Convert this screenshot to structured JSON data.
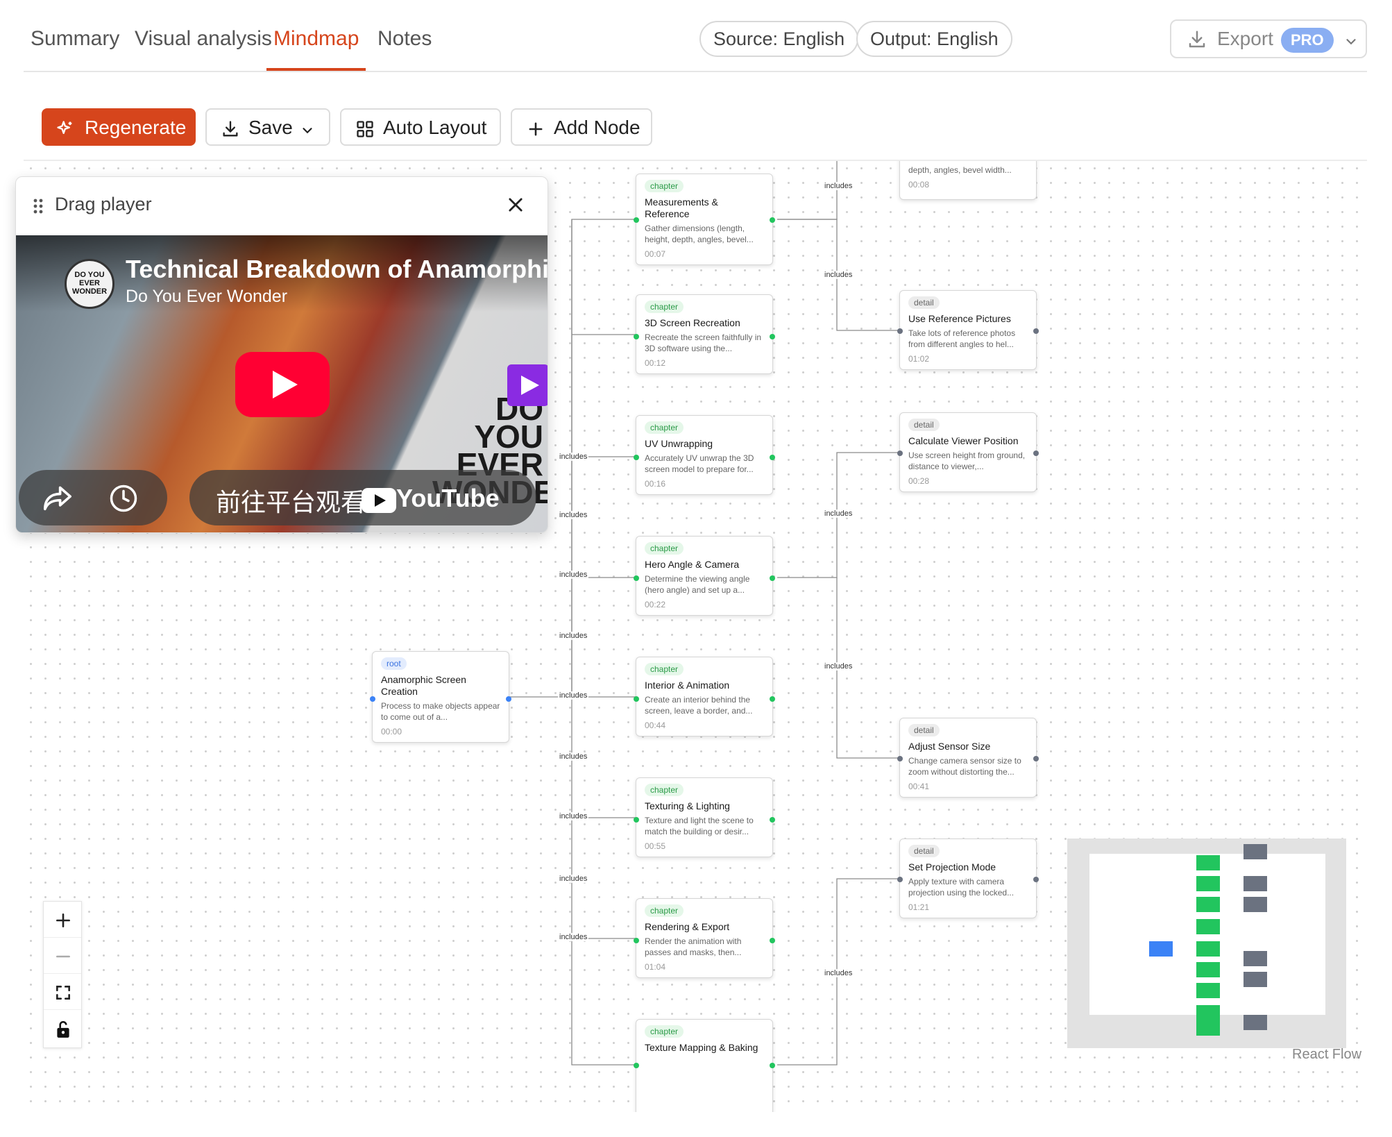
{
  "tabs": [
    "Summary",
    "Visual analysis",
    "Mindmap",
    "Notes"
  ],
  "active_tab": "Mindmap",
  "source_label": "Source: English",
  "output_label": "Output: English",
  "export": {
    "label": "Export",
    "badge": "PRO"
  },
  "toolbar": {
    "regenerate": "Regenerate",
    "save": "Save",
    "auto_layout": "Auto Layout",
    "add_node": "Add Node"
  },
  "player": {
    "header": "Drag player",
    "video_title": "Technical Breakdown of Anamorphic",
    "channel": "Do You Ever Wonder",
    "logo_text": "DO YOU EVER WONDER",
    "overlay_text": "DO YOU EVER WONDER",
    "watch_text": "前往平台观看：",
    "platform": "YouTube"
  },
  "edge_label": "includes",
  "root": {
    "type": "root",
    "title": "Anamorphic Screen Creation",
    "desc": "Process to make objects appear to come out of a...",
    "time": "00:00"
  },
  "chapters": [
    {
      "type": "chapter",
      "title": "Measurements & Reference",
      "desc": "Gather dimensions (length, height, depth, angles, bevel...",
      "time": "00:07"
    },
    {
      "type": "chapter",
      "title": "3D Screen Recreation",
      "desc": "Recreate the screen faithfully in 3D software using the...",
      "time": "00:12"
    },
    {
      "type": "chapter",
      "title": "UV Unwrapping",
      "desc": "Accurately UV unwrap the 3D screen model to prepare for...",
      "time": "00:16"
    },
    {
      "type": "chapter",
      "title": "Hero Angle & Camera",
      "desc": "Determine the viewing angle (hero angle) and set up a...",
      "time": "00:22"
    },
    {
      "type": "chapter",
      "title": "Interior & Animation",
      "desc": "Create an interior behind the screen, leave a border, and...",
      "time": "00:44"
    },
    {
      "type": "chapter",
      "title": "Texturing & Lighting",
      "desc": "Texture and light the scene to match the building or desir...",
      "time": "00:55"
    },
    {
      "type": "chapter",
      "title": "Rendering & Export",
      "desc": "Render the animation with passes and masks, then...",
      "time": "01:04"
    },
    {
      "type": "chapter",
      "title": "Texture Mapping & Baking",
      "desc": "",
      "time": ""
    }
  ],
  "details": [
    {
      "type": "detail",
      "title": "",
      "desc": "depth, angles, bevel width...",
      "time": "00:08"
    },
    {
      "type": "detail",
      "title": "Use Reference Pictures",
      "desc": "Take lots of reference photos from different angles to hel...",
      "time": "01:02"
    },
    {
      "type": "detail",
      "title": "Calculate Viewer Position",
      "desc": "Use screen height from ground, distance to viewer,...",
      "time": "00:28"
    },
    {
      "type": "detail",
      "title": "Adjust Sensor Size",
      "desc": "Change camera sensor size to zoom without distorting the...",
      "time": "00:41"
    },
    {
      "type": "detail",
      "title": "Set Projection Mode",
      "desc": "Apply texture with camera projection using the locked...",
      "time": "01:21"
    }
  ],
  "attribution": "React Flow",
  "colors": {
    "accent": "#d6451c",
    "chapter_handle": "#22c55e",
    "detail_handle": "#6b7280",
    "root_handle": "#3b82f6",
    "pro_badge": "#8aaef2"
  },
  "icons": [
    "sparkle-icon",
    "download-icon",
    "chevron-down-icon",
    "grid-icon",
    "plus-icon",
    "grip-icon",
    "close-icon",
    "share-icon",
    "clock-icon",
    "play-icon",
    "minus-icon",
    "fit-view-icon",
    "lock-icon"
  ]
}
